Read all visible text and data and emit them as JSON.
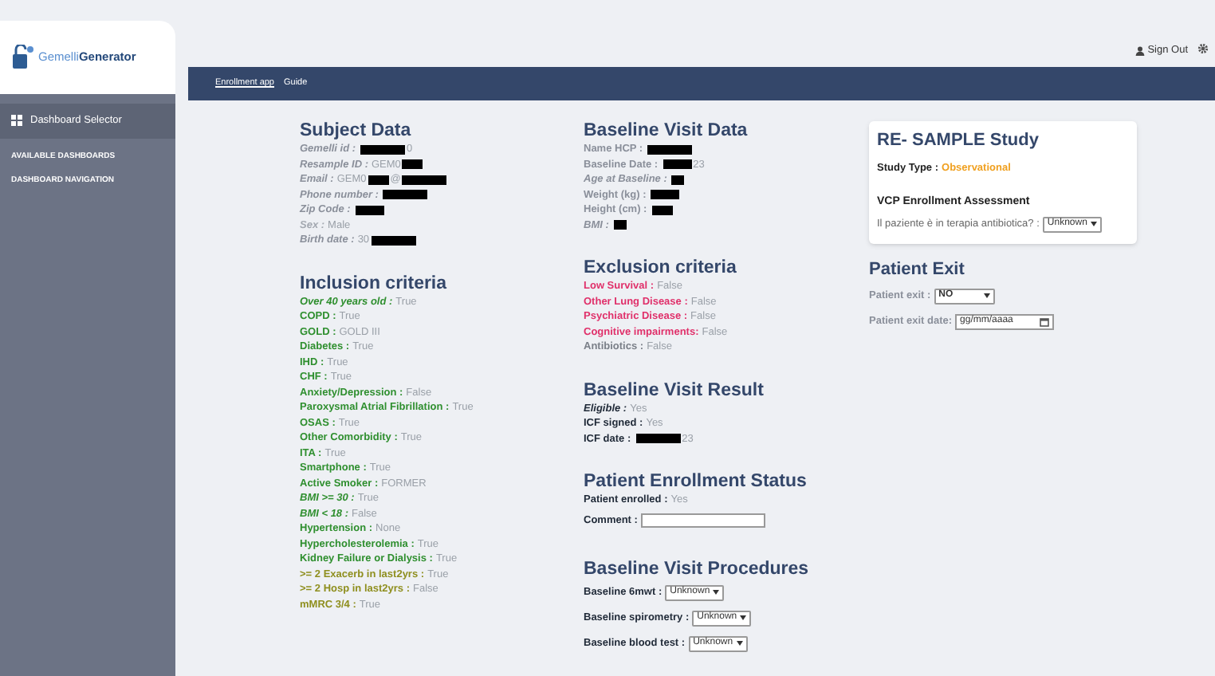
{
  "header": {
    "sign_out": "Sign Out"
  },
  "sidebar": {
    "logo": {
      "part_a": "Gemelli",
      "part_b": "Generator"
    },
    "items": [
      {
        "label": "Dashboard Selector",
        "kind": "selector"
      },
      {
        "label": "AVAILABLE DASHBOARDS",
        "kind": "heading"
      },
      {
        "label": "DASHBOARD NAVIGATION",
        "kind": "heading"
      }
    ]
  },
  "nav": {
    "links": [
      {
        "label": "Enrollment app",
        "selected": true
      },
      {
        "label": "Guide",
        "selected": false
      }
    ]
  },
  "columns": [
    {
      "sections": [
        {
          "title": "Subject Data",
          "fields": [
            {
              "label": "Gemelli id :",
              "italic": true,
              "parts": [
                {
                  "kind": "long"
                },
                {
                  "kind": "text",
                  "text": "0"
                }
              ],
              "color": "#8a8f9a"
            },
            {
              "label": "Resample ID :",
              "italic": true,
              "parts": [
                {
                  "kind": "text",
                  "text": "GEM0"
                },
                {
                  "kind": "short"
                }
              ],
              "color": "#8a8f9a"
            },
            {
              "label": "Email :",
              "italic": true,
              "parts": [
                {
                  "kind": "text",
                  "text": "GEM0"
                },
                {
                  "kind": "short"
                },
                {
                  "kind": "text",
                  "text": "@"
                },
                {
                  "kind": "long"
                }
              ],
              "color": "#8a8f9a"
            },
            {
              "label": "Phone number :",
              "italic": true,
              "parts": [
                {
                  "kind": "long"
                }
              ],
              "color": "#8a8f9a"
            },
            {
              "label": "Zip Code :",
              "italic": true,
              "parts": [
                {
                  "kind": "medium"
                }
              ],
              "color": "#8a8f9a"
            },
            {
              "label": "Sex :",
              "italic": true,
              "parts": [
                {
                  "kind": "text",
                  "text": "Male"
                }
              ],
              "color": "#a3a8b0"
            },
            {
              "label": "Birth date :",
              "italic": true,
              "parts": [
                {
                  "kind": "text",
                  "text": "30"
                },
                {
                  "kind": "long"
                }
              ],
              "color": "#8a8f9a"
            }
          ]
        },
        {
          "title": "Inclusion criteria",
          "fields": [
            {
              "label": "Over 40 years old :",
              "italic": true,
              "parts": [
                {
                  "kind": "text",
                  "text": "True"
                }
              ],
              "color": "#2f8f2f"
            },
            {
              "label": "COPD :",
              "italic": false,
              "parts": [
                {
                  "kind": "text",
                  "text": "True"
                }
              ],
              "color": "#2f8f2f"
            },
            {
              "label": "GOLD :",
              "italic": false,
              "parts": [
                {
                  "kind": "text",
                  "text": "GOLD III"
                }
              ],
              "color": "#2f8f2f"
            },
            {
              "label": "Diabetes :",
              "italic": false,
              "parts": [
                {
                  "kind": "text",
                  "text": "True"
                }
              ],
              "color": "#2f8f2f"
            },
            {
              "label": "IHD :",
              "italic": false,
              "parts": [
                {
                  "kind": "text",
                  "text": "True"
                }
              ],
              "color": "#2f8f2f"
            },
            {
              "label": "CHF :",
              "italic": false,
              "parts": [
                {
                  "kind": "text",
                  "text": "True"
                }
              ],
              "color": "#2f8f2f"
            },
            {
              "label": "Anxiety/Depression :",
              "italic": false,
              "parts": [
                {
                  "kind": "text",
                  "text": "False"
                }
              ],
              "color": "#2f8f2f"
            },
            {
              "label": "Paroxysmal Atrial Fibrillation :",
              "italic": false,
              "parts": [
                {
                  "kind": "text",
                  "text": "True"
                }
              ],
              "color": "#2f8f2f"
            },
            {
              "label": "OSAS :",
              "italic": false,
              "parts": [
                {
                  "kind": "text",
                  "text": "True"
                }
              ],
              "color": "#2f8f2f"
            },
            {
              "label": "Other Comorbidity :",
              "italic": false,
              "parts": [
                {
                  "kind": "text",
                  "text": "True"
                }
              ],
              "color": "#2f8f2f"
            },
            {
              "label": "ITA :",
              "italic": false,
              "parts": [
                {
                  "kind": "text",
                  "text": "True"
                }
              ],
              "color": "#2f8f2f"
            },
            {
              "label": "Smartphone :",
              "italic": false,
              "parts": [
                {
                  "kind": "text",
                  "text": "True"
                }
              ],
              "color": "#2f8f2f"
            },
            {
              "label": "Active Smoker :",
              "italic": false,
              "parts": [
                {
                  "kind": "text",
                  "text": "FORMER"
                }
              ],
              "color": "#2f8f2f"
            },
            {
              "label": "BMI >= 30 :",
              "italic": true,
              "parts": [
                {
                  "kind": "text",
                  "text": "True"
                }
              ],
              "color": "#2f8f2f"
            },
            {
              "label": "BMI < 18 :",
              "italic": true,
              "parts": [
                {
                  "kind": "text",
                  "text": "False"
                }
              ],
              "color": "#2f8f2f"
            },
            {
              "label": "Hypertension :",
              "italic": false,
              "parts": [
                {
                  "kind": "text",
                  "text": "None"
                }
              ],
              "color": "#2f8f2f"
            },
            {
              "label": "Hypercholesterolemia :",
              "italic": false,
              "parts": [
                {
                  "kind": "text",
                  "text": "True"
                }
              ],
              "color": "#2f8f2f"
            },
            {
              "label": "Kidney Failure or Dialysis :",
              "italic": false,
              "parts": [
                {
                  "kind": "text",
                  "text": "True"
                }
              ],
              "color": "#2f8f2f"
            },
            {
              "label": ">= 2 Exacerb in last2yrs :",
              "italic": false,
              "parts": [
                {
                  "kind": "text",
                  "text": "True"
                }
              ],
              "color": "#8f8f1f"
            },
            {
              "label": ">= 2 Hosp in last2yrs :",
              "italic": false,
              "parts": [
                {
                  "kind": "text",
                  "text": "False"
                }
              ],
              "color": "#8f8f1f"
            },
            {
              "label": "mMRC 3/4 :",
              "italic": false,
              "parts": [
                {
                  "kind": "text",
                  "text": "True"
                }
              ],
              "color": "#8f8f1f"
            }
          ]
        }
      ]
    },
    {
      "sections": [
        {
          "title": "Baseline Visit Data",
          "fields": [
            {
              "label": "Name HCP :",
              "italic": false,
              "parts": [
                {
                  "kind": "long"
                }
              ],
              "color": "#8a8f9a"
            },
            {
              "label": "Baseline Date :",
              "italic": false,
              "parts": [
                {
                  "kind": "medium"
                },
                {
                  "kind": "text",
                  "text": "23"
                }
              ],
              "color": "#8a8f9a"
            },
            {
              "label": "Age at Baseline :",
              "italic": true,
              "parts": [
                {
                  "kind": "tiny"
                }
              ],
              "color": "#8a8f9a"
            },
            {
              "label": "Weight (kg) :",
              "italic": false,
              "parts": [
                {
                  "kind": "medium"
                }
              ],
              "color": "#8a8f9a"
            },
            {
              "label": "Height (cm) :",
              "italic": false,
              "parts": [
                {
                  "kind": "short"
                }
              ],
              "color": "#8a8f9a"
            },
            {
              "label": "BMI :",
              "italic": true,
              "parts": [
                {
                  "kind": "tiny"
                }
              ],
              "color": "#8a8f9a"
            }
          ]
        },
        {
          "title": "Exclusion criteria",
          "fields": [
            {
              "label": "Low Survival :",
              "italic": false,
              "parts": [
                {
                  "kind": "text",
                  "text": "False"
                }
              ],
              "color": "#e0306a"
            },
            {
              "label": "Other Lung Disease :",
              "italic": false,
              "parts": [
                {
                  "kind": "text",
                  "text": "False"
                }
              ],
              "color": "#e0306a"
            },
            {
              "label": "Psychiatric Disease :",
              "italic": false,
              "parts": [
                {
                  "kind": "text",
                  "text": "False"
                }
              ],
              "color": "#e0306a"
            },
            {
              "label": "Cognitive impairments:",
              "italic": false,
              "parts": [
                {
                  "kind": "text",
                  "text": "False"
                }
              ],
              "color": "#e0306a"
            },
            {
              "label": "Antibiotics :",
              "italic": false,
              "parts": [
                {
                  "kind": "text",
                  "text": "False"
                }
              ],
              "color": "#7a7f88"
            }
          ]
        },
        {
          "title": "Baseline Visit Result",
          "fields": [
            {
              "label": "Eligible :",
              "italic": true,
              "parts": [
                {
                  "kind": "text",
                  "text": "Yes"
                }
              ],
              "color": "#1f2937"
            },
            {
              "label": "ICF signed :",
              "italic": false,
              "parts": [
                {
                  "kind": "text",
                  "text": "Yes"
                }
              ],
              "color": "#1f2937"
            },
            {
              "label": "ICF date :",
              "italic": false,
              "parts": [
                {
                  "kind": "long"
                },
                {
                  "kind": "text",
                  "text": "23"
                }
              ],
              "color": "#1f2937"
            }
          ]
        },
        {
          "title": "Patient Enrollment Status",
          "fields": [
            {
              "label": "Patient enrolled :",
              "italic": false,
              "parts": [
                {
                  "kind": "text",
                  "text": "Yes"
                }
              ],
              "color": "#1f2937"
            },
            {
              "label": "Comment :",
              "italic": false,
              "kind": "input",
              "color": "#1f2937"
            }
          ]
        },
        {
          "title": "Baseline Visit Procedures",
          "fields": [
            {
              "label": "Baseline 6mwt :",
              "italic": false,
              "kind": "select",
              "value": "Unknown",
              "color": "#1f2937"
            },
            {
              "label": "Baseline spirometry :",
              "italic": false,
              "kind": "select",
              "value": "Unknown",
              "color": "#1f2937"
            },
            {
              "label": "Baseline blood test :",
              "italic": false,
              "kind": "select",
              "value": "Unknown",
              "color": "#1f2937"
            }
          ]
        }
      ]
    }
  ],
  "study_card": {
    "title": "RE- SAMPLE Study",
    "type_label": "Study Type :",
    "type_value": "Observational",
    "subtitle": "VCP Enrollment Assessment",
    "question": "Il paziente è in terapia antibiotica? :",
    "answer": "Unknown"
  },
  "patient_exit": {
    "title": "Patient Exit",
    "fields": [
      {
        "label": "Patient exit :",
        "kind": "select",
        "value": "NO"
      },
      {
        "label": "Patient exit date:",
        "kind": "date",
        "placeholder": "gg/mm/aaaa"
      }
    ]
  }
}
